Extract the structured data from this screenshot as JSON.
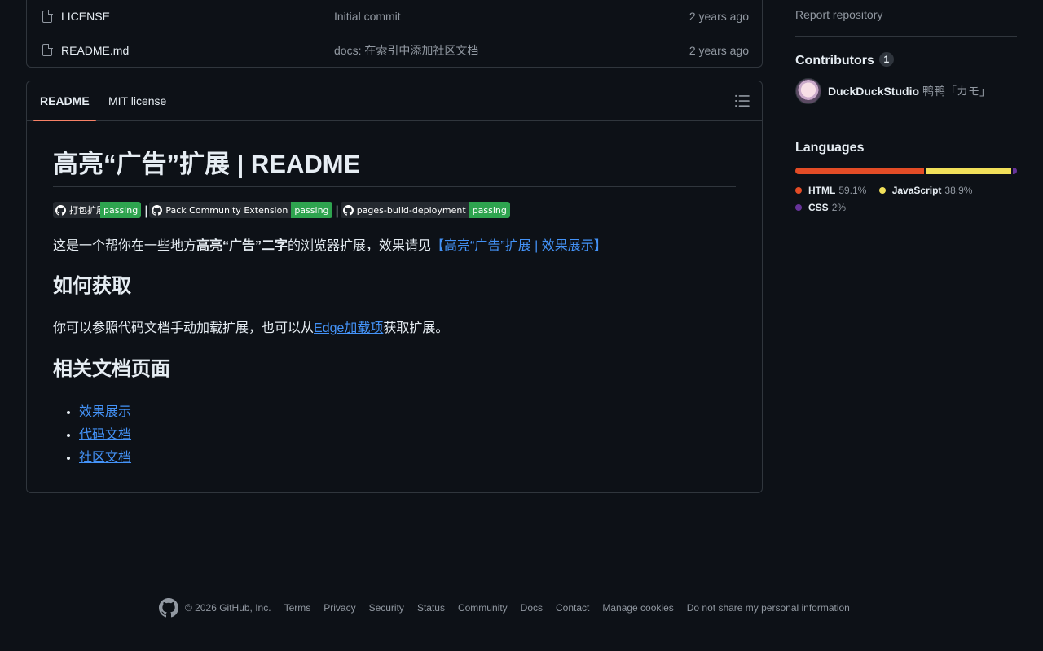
{
  "files": [
    {
      "name": "LICENSE",
      "message": "Initial commit",
      "time": "2 years ago"
    },
    {
      "name": "README.md",
      "message": "docs: 在索引中添加社区文档",
      "time": "2 years ago"
    }
  ],
  "readme": {
    "tabs": [
      "README",
      "MIT license"
    ],
    "title": "高亮“广告”扩展 | README",
    "badges": [
      {
        "label": "打包扩展",
        "status": "passing"
      },
      {
        "label": "Pack Community Extension",
        "status": "passing"
      },
      {
        "label": "pages-build-deployment",
        "status": "passing"
      }
    ],
    "separator": "|",
    "intro_prefix": "这是一个帮你在一些地方",
    "intro_bold": "高亮“广告”二字",
    "intro_middle": "的浏览器扩展，效果请见",
    "intro_link": "【高亮“广告”扩展 | 效果展示】",
    "h2_get": "如何获取",
    "get_prefix": "你可以参照代码文档手动加载扩展，也可以从",
    "get_link": "Edge加载项",
    "get_suffix": "获取扩展。",
    "h2_docs": "相关文档页面",
    "doc_links": [
      "效果展示",
      "代码文档",
      "社区文档"
    ]
  },
  "sidebar": {
    "report": "Report repository",
    "contributors_title": "Contributors",
    "contributors_count": "1",
    "contributor_login": "DuckDuckStudio",
    "contributor_name": "鸭鸭「カモ」",
    "languages_title": "Languages",
    "languages": [
      {
        "name": "HTML",
        "percent": "59.1%",
        "value": 59.1,
        "color": "#e34c26"
      },
      {
        "name": "JavaScript",
        "percent": "38.9%",
        "value": 38.9,
        "color": "#f1e05a"
      },
      {
        "name": "CSS",
        "percent": "2%",
        "value": 2.0,
        "color": "#663399"
      }
    ]
  },
  "footer": {
    "copyright": "© 2026 GitHub, Inc.",
    "links": [
      "Terms",
      "Privacy",
      "Security",
      "Status",
      "Community",
      "Docs",
      "Contact",
      "Manage cookies",
      "Do not share my personal information"
    ]
  },
  "icons": {
    "file": "file-icon",
    "outline": "list-unordered-icon",
    "github": "github-mark-icon"
  }
}
